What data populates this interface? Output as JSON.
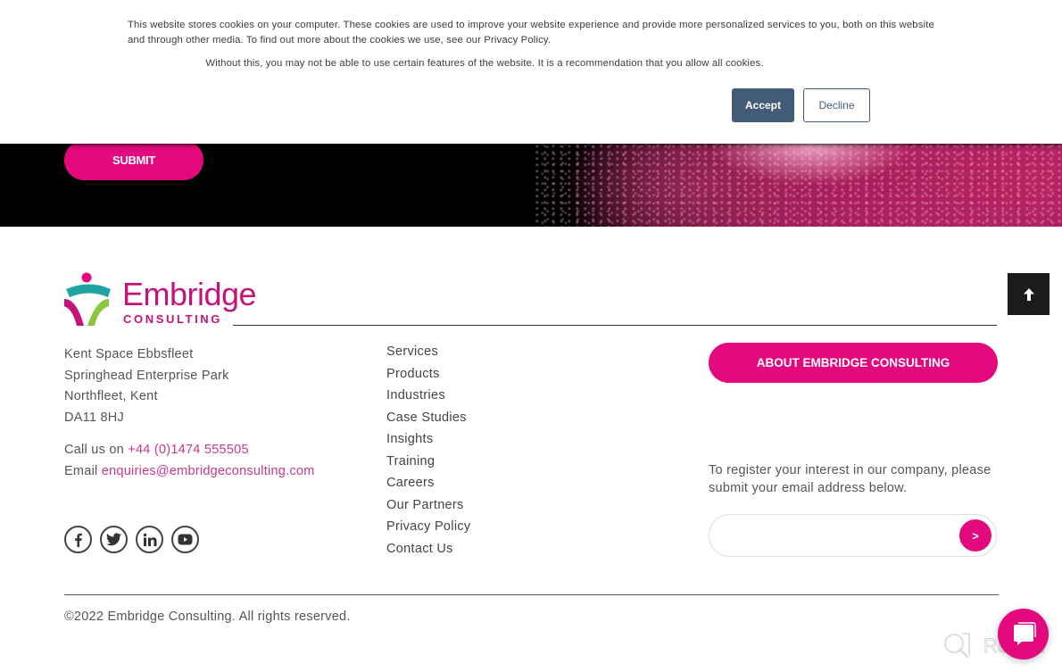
{
  "cookie_banner": {
    "message": "This website stores cookies on your computer. These cookies are used to improve your website experience and provide more personalized services to you, both on this website and through other media. To find out more about the cookies we use, see our Privacy Policy.",
    "recommendation": "Without this, you may not be able to use certain features of the website. It is a recommendation that you allow all cookies.",
    "accept_label": "Accept",
    "decline_label": "Decline"
  },
  "hero": {
    "submit_label": "SUBMIT"
  },
  "logo": {
    "name": "Embridge",
    "subtitle": "CONSULTING"
  },
  "address": {
    "lines": [
      "Kent Space Ebbsfleet",
      "Springhead Enterprise Park",
      "Northfleet, Kent",
      "DA11 8HJ"
    ]
  },
  "contact": {
    "call_prefix": "Call us on ",
    "phone": "+44 (0)1474 555505",
    "email_prefix": "Email ",
    "email": "enquiries@embridgeconsulting.com"
  },
  "social": [
    {
      "name": "facebook-icon"
    },
    {
      "name": "twitter-icon"
    },
    {
      "name": "linkedin-icon"
    },
    {
      "name": "youtube-icon"
    }
  ],
  "footer_nav": [
    {
      "label": "Services"
    },
    {
      "label": "Products"
    },
    {
      "label": "Industries"
    },
    {
      "label": "Case Studies"
    },
    {
      "label": "Insights"
    },
    {
      "label": "Training"
    },
    {
      "label": "Careers"
    },
    {
      "label": "Our Partners"
    },
    {
      "label": "Privacy Policy"
    },
    {
      "label": "Contact Us"
    }
  ],
  "about": {
    "button_label": "ABOUT EMBRIDGE CONSULTING"
  },
  "register": {
    "text": "To register your interest in our company, please submit your email address below.",
    "input_value": "",
    "input_placeholder": "",
    "submit_label": ">"
  },
  "footer": {
    "copyright": "©2022 Embridge Consulting. All rights reserved."
  },
  "widgets": {
    "revain_label": "Revain"
  },
  "colors": {
    "brand_pink": "#e4087e",
    "cookie_accent": "#425b76",
    "link_pink": "#c4398a",
    "logo_teal": "#1fa3a3",
    "logo_green": "#8cc63f"
  }
}
